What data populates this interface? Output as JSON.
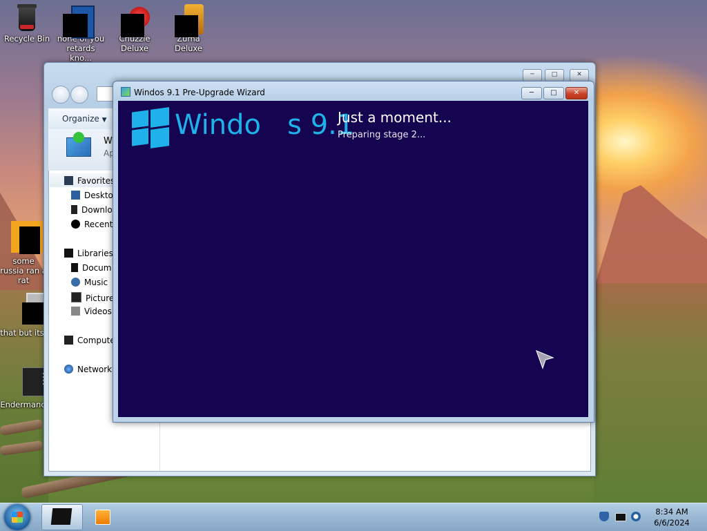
{
  "desktop": {
    "icons": [
      {
        "label": "Recycle Bin"
      },
      {
        "label": "none of you retards kno..."
      },
      {
        "label": "Chuzzle Deluxe"
      },
      {
        "label": "Zuma Deluxe"
      },
      {
        "label": "some russia ran a rat"
      },
      {
        "label": "that but its"
      },
      {
        "label": "Endermanc"
      }
    ]
  },
  "explorer": {
    "toolbar": {
      "organize_label": "Organize"
    },
    "detail_title": "Wi",
    "detail_sub": "Ap",
    "nav": {
      "favorites": "Favorites",
      "desktop": "Desktop",
      "downloads": "Downlo",
      "recent": "Recent",
      "libraries": "Libraries",
      "documents": "Docum",
      "music": "Music",
      "pictures": "Pictures",
      "videos": "Videos",
      "computer": "Compute",
      "network": "Network"
    }
  },
  "wizard": {
    "title": "Windos 9.1 Pre-Upgrade Wizard",
    "brand": "Windo   s 9.1",
    "heading": "Just a moment...",
    "status": "Preparing stage 2...",
    "colors": {
      "background": "#150550",
      "accent": "#1fb2ea"
    }
  },
  "taskbar": {
    "time": "8:34 AM",
    "date": "6/6/2024"
  }
}
